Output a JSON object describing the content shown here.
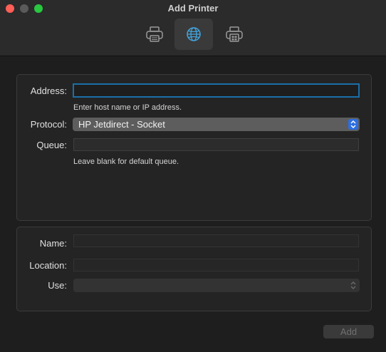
{
  "window": {
    "title": "Add Printer"
  },
  "toolbar": {
    "buttons": [
      {
        "icon": "printer-icon",
        "selected": false
      },
      {
        "icon": "globe-icon",
        "selected": true
      },
      {
        "icon": "windows-printer-icon",
        "selected": false
      }
    ]
  },
  "connection": {
    "address_label": "Address:",
    "address_value": "",
    "address_hint": "Enter host name or IP address.",
    "protocol_label": "Protocol:",
    "protocol_value": "HP Jetdirect - Socket",
    "queue_label": "Queue:",
    "queue_value": "",
    "queue_hint": "Leave blank for default queue."
  },
  "details": {
    "name_label": "Name:",
    "name_value": "",
    "location_label": "Location:",
    "location_value": "",
    "use_label": "Use:",
    "use_value": ""
  },
  "footer": {
    "add_label": "Add"
  },
  "colors": {
    "close": "#fe5f57",
    "zoom": "#28c840",
    "accent": "#2d6ee0",
    "focus_ring": "#1b6fa8"
  }
}
